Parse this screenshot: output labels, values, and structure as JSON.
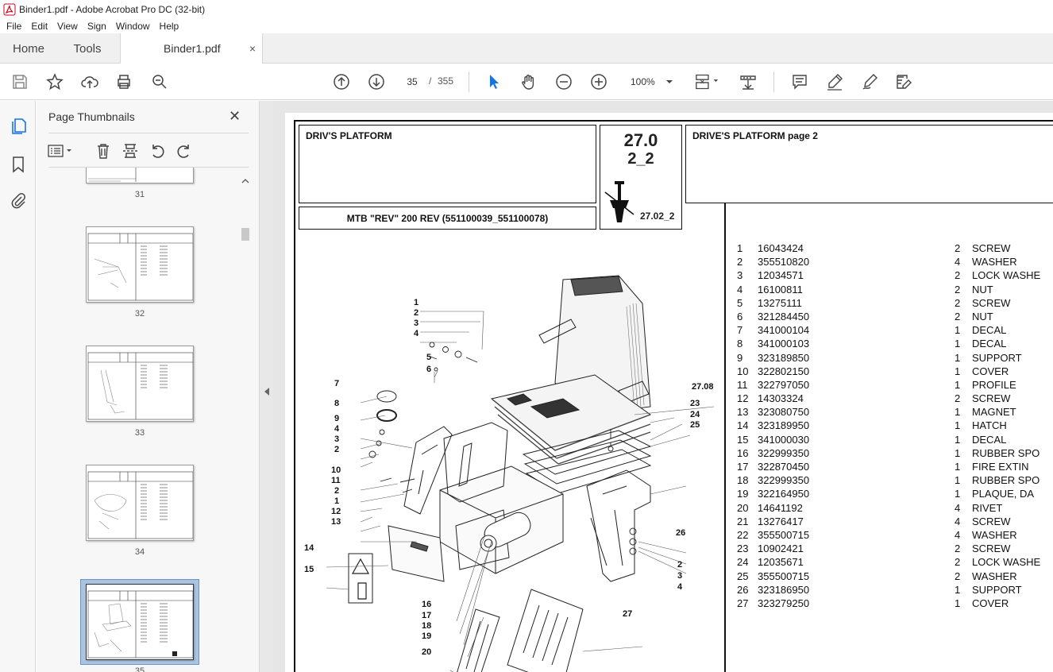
{
  "window": {
    "title": "Binder1.pdf - Adobe Acrobat Pro DC (32-bit)"
  },
  "menu": [
    "File",
    "Edit",
    "View",
    "Sign",
    "Window",
    "Help"
  ],
  "tabs": {
    "home": "Home",
    "tools": "Tools",
    "document": "Binder1.pdf",
    "close_glyph": "×"
  },
  "toolbar": {
    "current_page": "35",
    "page_separator": "/",
    "total_pages": "355",
    "zoom": "100%"
  },
  "thumbnails_panel": {
    "title": "Page Thumbnails",
    "close_glyph": "✕",
    "pages": [
      {
        "label": "31"
      },
      {
        "label": "32"
      },
      {
        "label": "33"
      },
      {
        "label": "34"
      },
      {
        "label": "35",
        "selected": true
      }
    ]
  },
  "document": {
    "left_header": "DRIV'S PLATFORM",
    "model": "MTB \"REV\" 200 REV (551100039_551100078)",
    "section_number": "27.0",
    "section_sub": "2_2",
    "section_ref": "27.02_2",
    "right_header": "DRIVE'S PLATFORM  page 2",
    "parts": [
      {
        "no": "1",
        "code": "16043424",
        "qty": "2",
        "desc": "SCREW"
      },
      {
        "no": "2",
        "code": "355510820",
        "qty": "4",
        "desc": "WASHER"
      },
      {
        "no": "3",
        "code": "12034571",
        "qty": "2",
        "desc": "LOCK WASHE"
      },
      {
        "no": "4",
        "code": "16100811",
        "qty": "2",
        "desc": "NUT"
      },
      {
        "no": "5",
        "code": "13275111",
        "qty": "2",
        "desc": "SCREW"
      },
      {
        "no": "6",
        "code": "321284450",
        "qty": "2",
        "desc": "NUT"
      },
      {
        "no": "7",
        "code": "341000104",
        "qty": "1",
        "desc": "DECAL"
      },
      {
        "no": "8",
        "code": "341000103",
        "qty": "1",
        "desc": "DECAL"
      },
      {
        "no": "9",
        "code": "323189850",
        "qty": "1",
        "desc": "SUPPORT"
      },
      {
        "no": "10",
        "code": "322802150",
        "qty": "1",
        "desc": "COVER"
      },
      {
        "no": "11",
        "code": "322797050",
        "qty": "1",
        "desc": "PROFILE"
      },
      {
        "no": "12",
        "code": "14303324",
        "qty": "2",
        "desc": "SCREW"
      },
      {
        "no": "13",
        "code": "323080750",
        "qty": "1",
        "desc": "MAGNET"
      },
      {
        "no": "14",
        "code": "323189950",
        "qty": "1",
        "desc": "HATCH"
      },
      {
        "no": "15",
        "code": "341000030",
        "qty": "1",
        "desc": "DECAL"
      },
      {
        "no": "16",
        "code": "322999350",
        "qty": "1",
        "desc": "RUBBER SPO"
      },
      {
        "no": "17",
        "code": "322870450",
        "qty": "1",
        "desc": "FIRE EXTIN"
      },
      {
        "no": "18",
        "code": "322999350",
        "qty": "1",
        "desc": "RUBBER SPO"
      },
      {
        "no": "19",
        "code": "322164950",
        "qty": "1",
        "desc": "PLAQUE, DA"
      },
      {
        "no": "20",
        "code": "14641192",
        "qty": "4",
        "desc": "RIVET"
      },
      {
        "no": "21",
        "code": "13276417",
        "qty": "4",
        "desc": "SCREW"
      },
      {
        "no": "22",
        "code": "355500715",
        "qty": "4",
        "desc": "WASHER"
      },
      {
        "no": "23",
        "code": "10902421",
        "qty": "2",
        "desc": "SCREW"
      },
      {
        "no": "24",
        "code": "12035671",
        "qty": "2",
        "desc": "LOCK WASHE"
      },
      {
        "no": "25",
        "code": "355500715",
        "qty": "2",
        "desc": "WASHER"
      },
      {
        "no": "26",
        "code": "323186950",
        "qty": "1",
        "desc": "SUPPORT"
      },
      {
        "no": "27",
        "code": "323279250",
        "qty": "1",
        "desc": "COVER"
      }
    ],
    "callouts": {
      "c1": "1",
      "c2": "2",
      "c3": "3",
      "c4": "4",
      "c5": "5",
      "c6": "6",
      "c7": "7",
      "c8": "8",
      "c9": "9",
      "c4b": "4",
      "c3b": "3",
      "c2b": "2",
      "c10": "10",
      "c11": "11",
      "c2c": "2",
      "c1b": "1",
      "c12": "12",
      "c13": "13",
      "c14": "14",
      "c15": "15",
      "c16": "16",
      "c17": "17",
      "c18": "18",
      "c19": "19",
      "c20": "20",
      "c2708": "27.08",
      "c23": "23",
      "c24": "24",
      "c25": "25",
      "c26": "26",
      "c2d": "2",
      "c3c": "3",
      "c4c": "4",
      "c27": "27"
    }
  },
  "colors": {
    "accent": "#1473e6",
    "tab_bar_bg": "#f0f0f0",
    "selection_bg": "#a9c4e2"
  }
}
